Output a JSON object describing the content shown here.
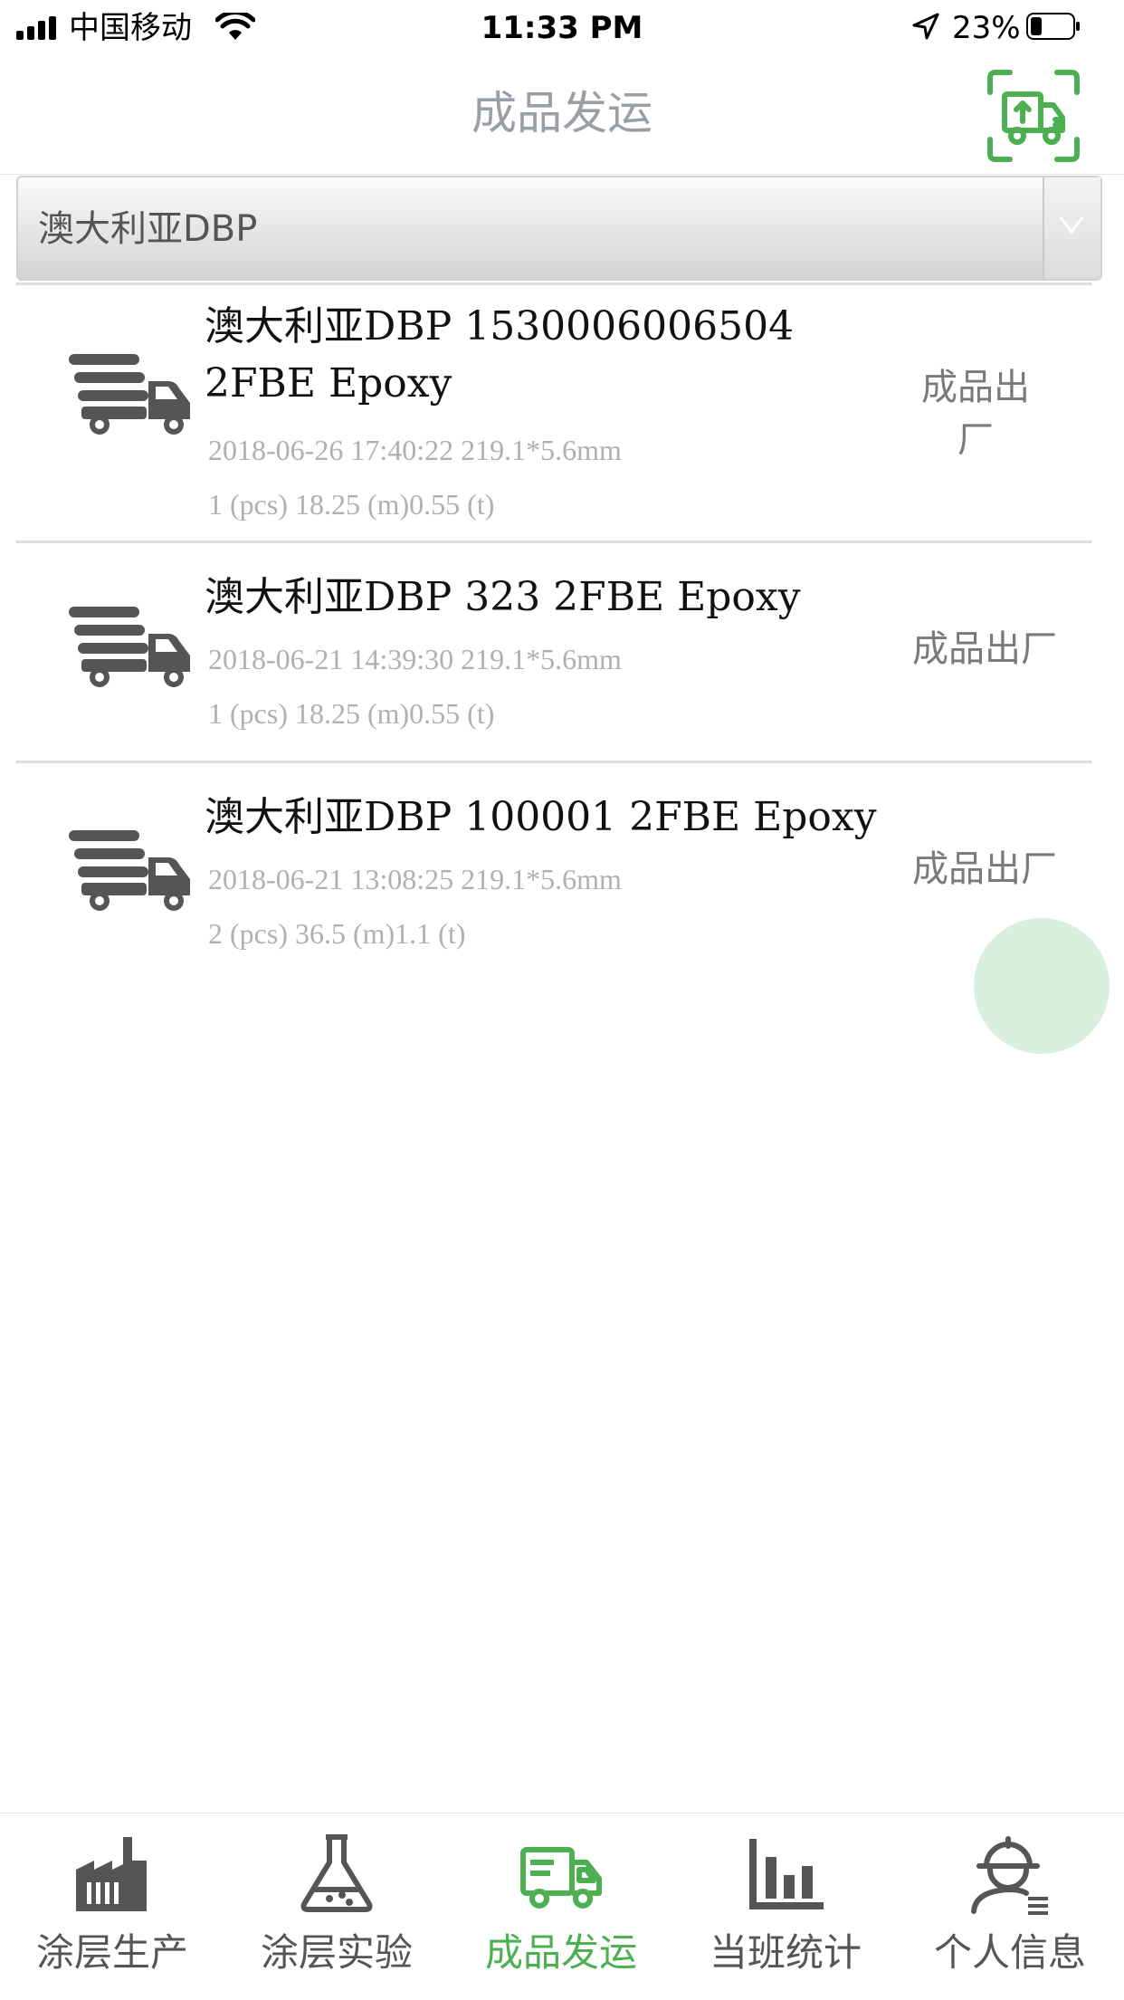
{
  "status_bar": {
    "carrier": "中国移动",
    "time": "11:33 PM",
    "battery": "23%"
  },
  "nav": {
    "title": "成品发运",
    "scan_icon": "truck-scan-icon"
  },
  "filter": {
    "selected": "澳大利亚DBP"
  },
  "shipments": [
    {
      "title": "澳大利亚DBP 1530006006504 2FBE Epoxy",
      "datetime_spec": "2018-06-26 17:40:22 219.1*5.6mm",
      "pcs": "1 (pcs)",
      "meters": "18.25 (m)",
      "tons": "0.55 (t)",
      "status": "成品出厂"
    },
    {
      "title": "澳大利亚DBP 323 2FBE Epoxy",
      "datetime_spec": "2018-06-21 14:39:30 219.1*5.6mm",
      "pcs": "1 (pcs)",
      "meters": "18.25 (m)",
      "tons": "0.55 (t)",
      "status": "成品出厂"
    },
    {
      "title": "澳大利亚DBP 100001 2FBE Epoxy",
      "datetime_spec": "2018-06-21 13:08:25 219.1*5.6mm",
      "pcs": "2 (pcs)",
      "meters": "36.5 (m)",
      "tons": "1.1 (t)",
      "status": "成品出厂"
    }
  ],
  "tabs": [
    {
      "label": "涂层生产",
      "icon": "factory-icon",
      "active": false
    },
    {
      "label": "涂层实验",
      "icon": "flask-icon",
      "active": false
    },
    {
      "label": "成品发运",
      "icon": "truck-icon",
      "active": true
    },
    {
      "label": "当班统计",
      "icon": "bar-chart-icon",
      "active": false
    },
    {
      "label": "个人信息",
      "icon": "worker-icon",
      "active": false
    }
  ],
  "colors": {
    "accent": "#4caf50",
    "title_gray": "#9a9fa6",
    "float_button": "#d9f0de"
  }
}
